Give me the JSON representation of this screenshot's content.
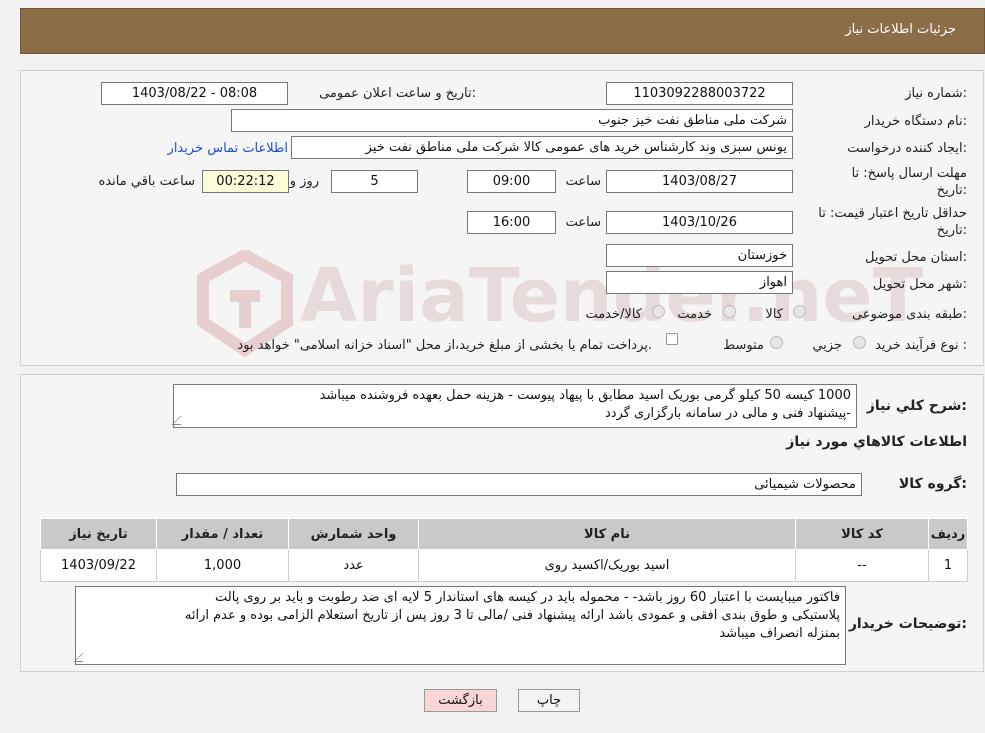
{
  "header": {
    "title": "جزئیات اطلاعات نیاز"
  },
  "watermark": {
    "text": "AriaTender.neT"
  },
  "form": {
    "need_number_label": "شماره نیاز:",
    "need_number": "1103092288003722",
    "announce_label": "تاریخ و ساعت اعلان عمومی:",
    "announce_value": "1403/08/22 - 08:08",
    "buyer_org_label": "نام دستگاه خریدار:",
    "buyer_org": "شرکت ملی مناطق نفت خیز جنوب",
    "creator_label": "ایجاد کننده درخواست:",
    "creator": "یونس سبزی وند کارشناس خرید های عمومی کالا شرکت ملی مناطق نفت خیز",
    "contact_link": "اطلاعات تماس خریدار",
    "deadline_label_1": "مهلت ارسال پاسخ: تا",
    "deadline_label_2": "تاریخ:",
    "deadline_date": "1403/08/27",
    "time_label": "ساعت",
    "deadline_time": "09:00",
    "days_value": "5",
    "days_label": "روز و",
    "remaining_time": "00:22:12",
    "remaining_label": "ساعت باقي مانده",
    "validity_label_1": "حداقل تاریخ اعتبار قیمت: تا",
    "validity_label_2": "تاریخ:",
    "validity_date": "1403/10/26",
    "validity_time": "16:00",
    "province_label": "استان محل تحویل:",
    "province": "خوزستان",
    "city_label": "شهر محل تحویل:",
    "city": "اهواز",
    "category_label": "طبقه بندی موضوعی:",
    "category_options": [
      "کالا",
      "خدمت",
      "کالا/خدمت"
    ],
    "process_label": "نوع فرآیند خرید :",
    "process_options": [
      "جزیي",
      "متوسط"
    ],
    "process_note": "پرداخت تمام یا بخشی از مبلغ خرید،از محل \"اسناد خزانه اسلامی\" خواهد بود."
  },
  "description": {
    "label": "شرح کلي نياز:",
    "line1": "1000 کیسه 50 کیلو گرمی بوریک اسید مطابق با پیهاد پیوست - هزینه حمل بعهده فروشنده میباشد",
    "line2": "-پیشنهاد فنی و مالی در سامانه بارگزاری گردد"
  },
  "goods": {
    "section_title": "اطلاعات کالاهاي مورد نياز",
    "group_label": "گروه کالا:",
    "group_value": "محصولات شیمیائی"
  },
  "table": {
    "headers": [
      "ردیف",
      "کد کالا",
      "نام کالا",
      "واحد شمارش",
      "تعداد / مقدار",
      "تاریخ نیاز"
    ],
    "rows": [
      {
        "row": "1",
        "code": "--",
        "name": "اسید بوریک/اکسید روی",
        "unit": "عدد",
        "qty": "1,000",
        "date": "1403/09/22"
      }
    ]
  },
  "buyer_notes": {
    "label": "توضیحات خریدار:",
    "line1": "فاکتور میبایست با اعتبار 60 روز باشد- - محموله باید در کیسه های استاندار 5 لایه ای ضد رطوبت و باید بر روی پالت",
    "line2": "پلاستیکی و طوق بندی افقی و عمودی باشد ارائه پیشنهاد فنی /مالی تا 3 روز پس از تاریخ استعلام الزامی بوده و عدم ارائه",
    "line3": "بمنزله انصراف میباشد"
  },
  "buttons": {
    "print": "چاپ",
    "back": "بازگشت"
  }
}
